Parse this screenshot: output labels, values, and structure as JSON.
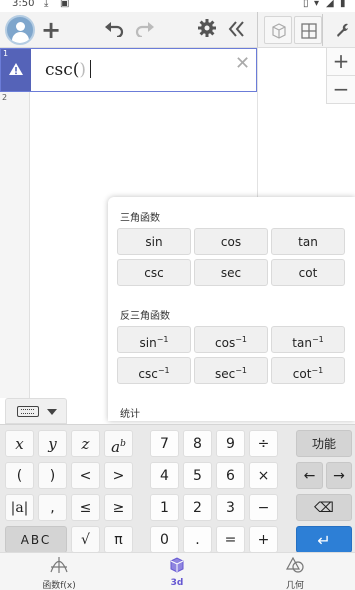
{
  "status_bar": {
    "time": "3:50"
  },
  "algebra": {
    "row1_number": "1",
    "row1_function": "csc(",
    "row1_close_paren": ")",
    "row2_number": "2"
  },
  "zoom": {
    "zoom_in": "+",
    "zoom_out": "−"
  },
  "popup": {
    "trig_title": "三角函数",
    "trig": [
      "sin",
      "cos",
      "tan",
      "csc",
      "sec",
      "cot"
    ],
    "inverse_title": "反三角函数",
    "inverse": [
      {
        "base": "sin",
        "exp": "−1"
      },
      {
        "base": "cos",
        "exp": "−1"
      },
      {
        "base": "tan",
        "exp": "−1"
      },
      {
        "base": "csc",
        "exp": "−1"
      },
      {
        "base": "sec",
        "exp": "−1"
      },
      {
        "base": "cot",
        "exp": "−1"
      }
    ],
    "stats_title": "统计"
  },
  "keyboard": {
    "row1": {
      "x": "x",
      "y": "y",
      "z": "z",
      "a": "a",
      "b": "b",
      "n7": "7",
      "n8": "8",
      "n9": "9",
      "div": "÷",
      "func": "功能"
    },
    "row2": {
      "lparen": "(",
      "rparen": ")",
      "lt": "<",
      "gt": ">",
      "n4": "4",
      "n5": "5",
      "n6": "6",
      "mul": "×",
      "left": "←",
      "right": "→"
    },
    "row3": {
      "abs": "|a|",
      "comma": ",",
      "le": "≤",
      "ge": "≥",
      "n1": "1",
      "n2": "2",
      "n3": "3",
      "minus": "−",
      "backspace": "⌫"
    },
    "row4": {
      "abc": "ABC",
      "sqrt": "√",
      "pi": "π",
      "n0": "0",
      "dot": ".",
      "eq": "=",
      "plus": "+",
      "enter": "↵"
    }
  },
  "bottom_nav": {
    "items": [
      "函数f(x)",
      "3d",
      "几何"
    ],
    "active_index": 1
  },
  "colors": {
    "accent": "#6557d2",
    "selection_border": "#6b7cd8",
    "marker": "#5563b8",
    "enter_key": "#2d7fd6"
  }
}
